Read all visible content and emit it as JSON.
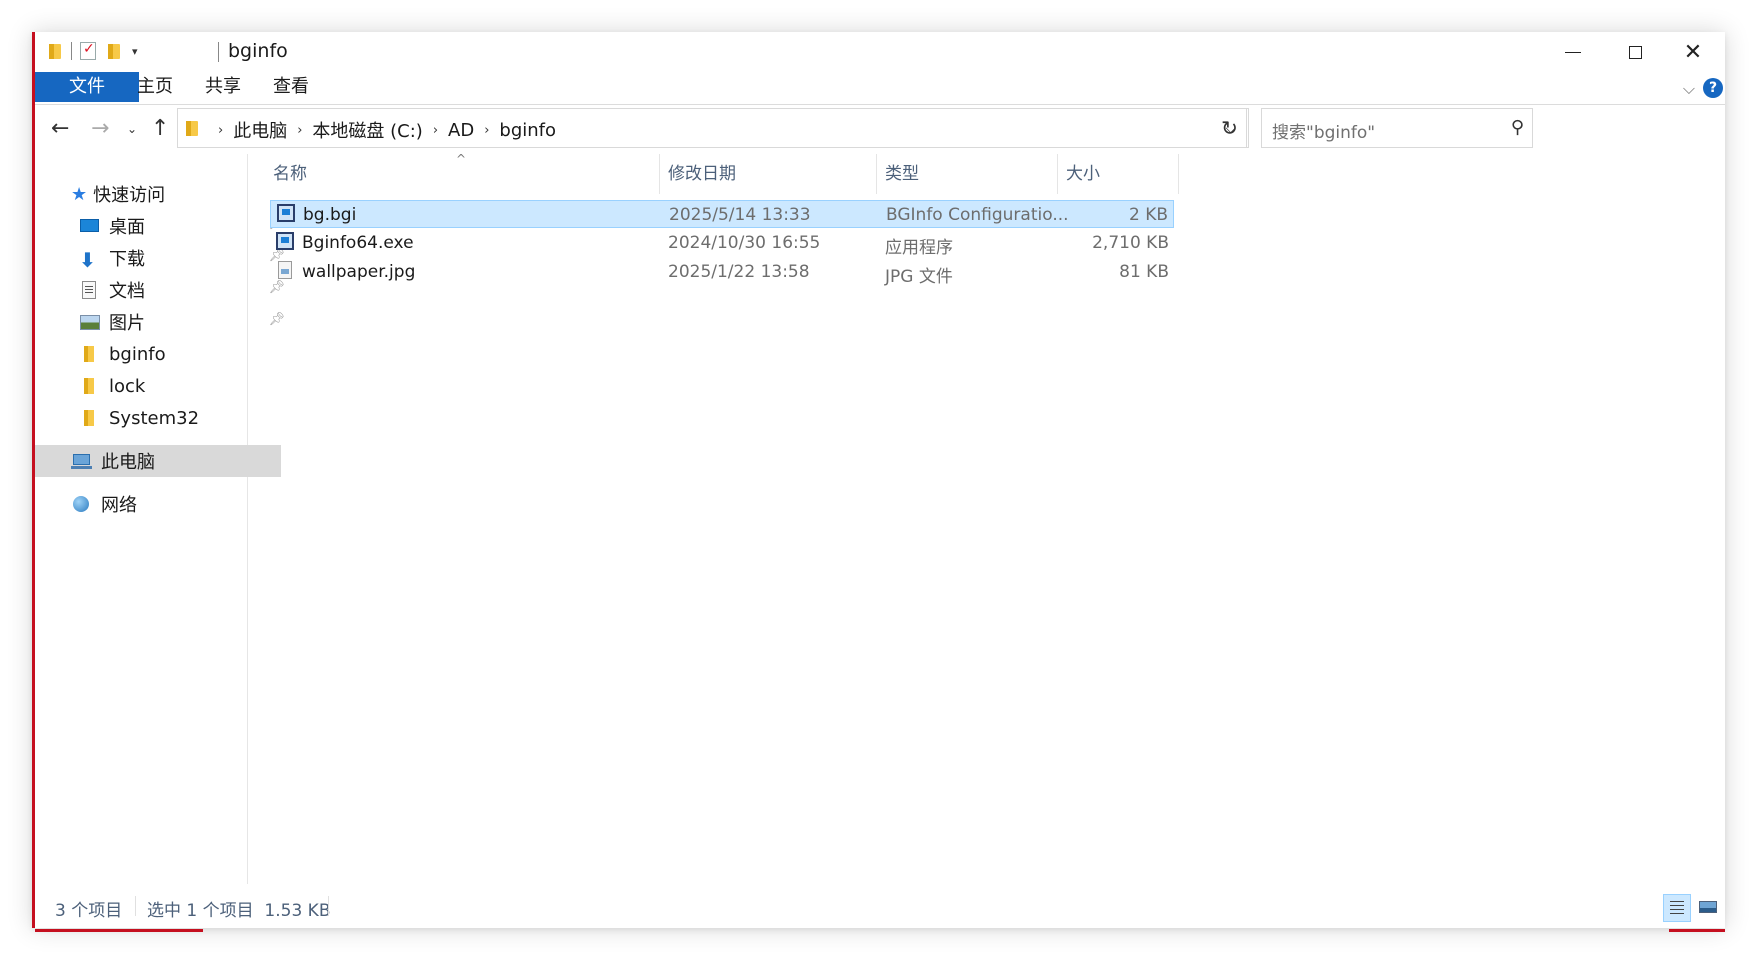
{
  "window": {
    "title": "bginfo"
  },
  "ribbon": {
    "tabs": [
      {
        "label": "文件"
      },
      {
        "label": "主页"
      },
      {
        "label": "共享"
      },
      {
        "label": "查看"
      }
    ]
  },
  "address": {
    "crumbs": [
      "此电脑",
      "本地磁盘 (C:)",
      "AD",
      "bginfo"
    ]
  },
  "search": {
    "placeholder": "搜索\"bginfo\""
  },
  "sidebar": {
    "quick_access": "快速访问",
    "items": [
      {
        "label": "桌面",
        "icon": "desktop-icon",
        "pinned": true
      },
      {
        "label": "下载",
        "icon": "download-icon",
        "pinned": true
      },
      {
        "label": "文档",
        "icon": "documents-icon",
        "pinned": true
      },
      {
        "label": "图片",
        "icon": "pictures-icon",
        "pinned": true
      },
      {
        "label": "bginfo",
        "icon": "folder-icon",
        "pinned": false
      },
      {
        "label": "lock",
        "icon": "folder-icon",
        "pinned": false
      },
      {
        "label": "System32",
        "icon": "folder-icon",
        "pinned": false
      }
    ],
    "this_pc": "此电脑",
    "network": "网络"
  },
  "filelist": {
    "columns": [
      "名称",
      "修改日期",
      "类型",
      "大小"
    ],
    "rows": [
      {
        "name": "bg.bgi",
        "modified": "2025/5/14 13:33",
        "type": "BGInfo Configuratio...",
        "size": "2 KB",
        "icon": "bginfo-file-icon",
        "selected": true
      },
      {
        "name": "Bginfo64.exe",
        "modified": "2024/10/30 16:55",
        "type": "应用程序",
        "size": "2,710 KB",
        "icon": "bginfo-app-icon",
        "selected": false
      },
      {
        "name": "wallpaper.jpg",
        "modified": "2025/1/22 13:58",
        "type": "JPG 文件",
        "size": "81 KB",
        "icon": "image-file-icon",
        "selected": false
      }
    ]
  },
  "status": {
    "count": "3 个项目",
    "selection": "选中 1 个项目  1.53 KB"
  },
  "colors": {
    "accent": "#1667c1",
    "selection": "#cce8ff",
    "window_border": "#c50f1f"
  }
}
